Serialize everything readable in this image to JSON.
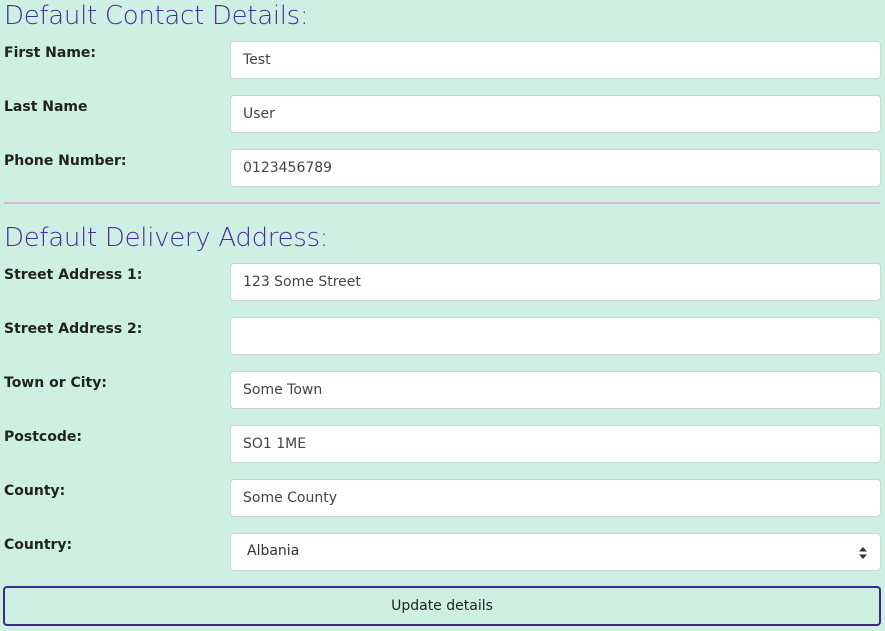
{
  "contact": {
    "title": "Default Contact Details:",
    "fields": [
      {
        "label": "First Name:",
        "value": "Test"
      },
      {
        "label": "Last Name",
        "value": "User"
      },
      {
        "label": "Phone Number:",
        "value": "0123456789"
      }
    ]
  },
  "delivery": {
    "title": "Default Delivery Address:",
    "fields": [
      {
        "label": "Street Address 1:",
        "value": "123 Some Street"
      },
      {
        "label": "Street Address 2:",
        "value": ""
      },
      {
        "label": "Town or City:",
        "value": "Some Town"
      },
      {
        "label": "Postcode:",
        "value": "SO1 1ME"
      },
      {
        "label": "County:",
        "value": "Some County"
      }
    ],
    "country": {
      "label": "Country:",
      "selected": "Albania"
    }
  },
  "actions": {
    "update_label": "Update details"
  },
  "colors": {
    "background": "#cdf0e2",
    "heading": "#4b2a9c",
    "button_border": "#3d2a88",
    "divider": "#d7b9d9"
  },
  "icons": {
    "select_arrow": "sort-arrows-icon"
  }
}
